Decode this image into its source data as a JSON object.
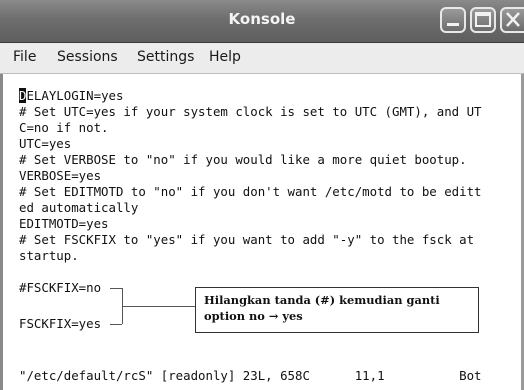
{
  "window": {
    "title": "Konsole",
    "buttons": [
      "minimize-icon",
      "maximize-icon",
      "close-icon"
    ]
  },
  "menubar": {
    "items": [
      {
        "label": "File"
      },
      {
        "label": "Sessions"
      },
      {
        "label": "Settings"
      },
      {
        "label": "Help"
      }
    ]
  },
  "terminal": {
    "cursor_char": "D",
    "first_line_rest": "ELAYLOGIN=yes",
    "lines": [
      "# Set UTC=yes if your system clock is set to UTC (GMT), and UT",
      "C=no if not.",
      "UTC=yes",
      "# Set VERBOSE to \"no\" if you would like a more quiet bootup.",
      "VERBOSE=yes",
      "# Set EDITMOTD to \"no\" if you don't want /etc/motd to be editt",
      "ed automatically",
      "EDITMOTD=yes",
      "# Set FSCKFIX to \"yes\" if you want to add \"-y\" to the fsck at",
      "startup.",
      "#FSCKFIX=no",
      "",
      "FSCKFIX=yes"
    ],
    "status_line": "\"/etc/default/rcS\" [readonly] 23L, 658C      11,1          Bot"
  },
  "annotation": {
    "line1": "Hilangkan tanda (#) kemudian ganti",
    "line2": "option no → yes"
  }
}
